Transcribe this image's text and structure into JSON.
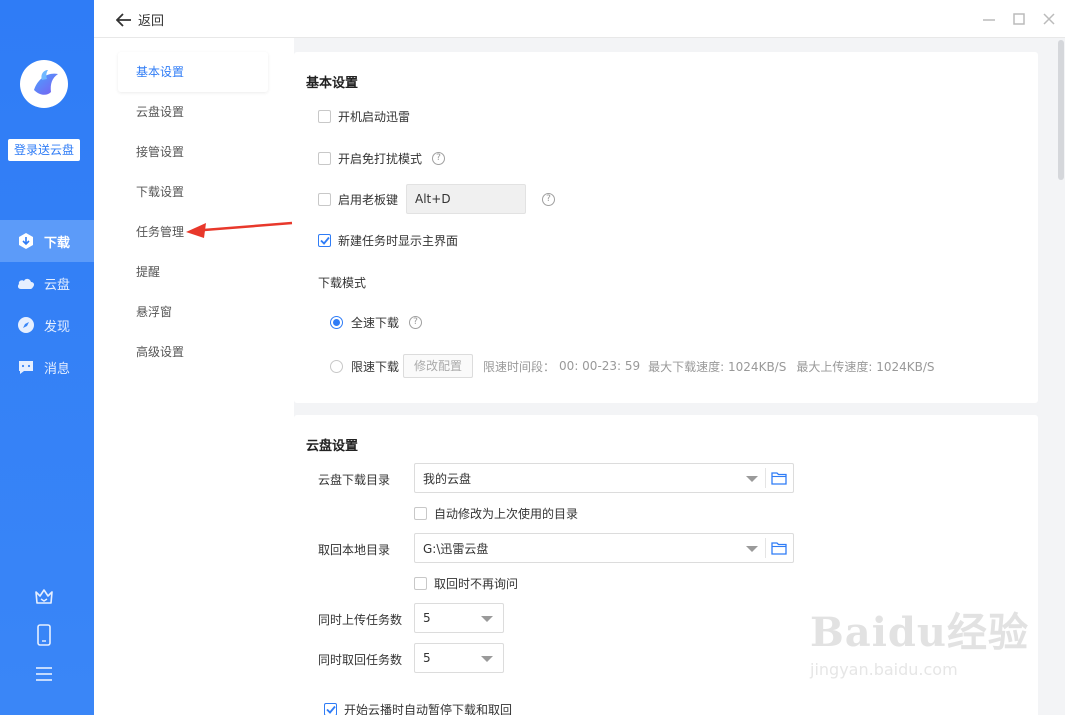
{
  "sidebar": {
    "login_label": "登录送云盘",
    "items": [
      {
        "label": "下载",
        "icon": "download-icon",
        "active": true
      },
      {
        "label": "云盘",
        "icon": "cloud-icon",
        "active": false
      },
      {
        "label": "发现",
        "icon": "compass-icon",
        "active": false
      },
      {
        "label": "消息",
        "icon": "message-icon",
        "active": false
      }
    ],
    "bottom_icons": [
      "crown-icon",
      "phone-icon",
      "menu-icon"
    ]
  },
  "header": {
    "back_label": "返回"
  },
  "settings_nav": {
    "items": [
      {
        "label": "基本设置",
        "active": true
      },
      {
        "label": "云盘设置",
        "active": false
      },
      {
        "label": "接管设置",
        "active": false
      },
      {
        "label": "下载设置",
        "active": false
      },
      {
        "label": "任务管理",
        "active": false
      },
      {
        "label": "提醒",
        "active": false
      },
      {
        "label": "悬浮窗",
        "active": false
      },
      {
        "label": "高级设置",
        "active": false
      }
    ]
  },
  "basic": {
    "title": "基本设置",
    "startup_label": "开机启动迅雷",
    "startup_checked": false,
    "quiet_label": "开启免打扰模式",
    "quiet_checked": false,
    "boss_key_label": "启用老板键",
    "boss_key_checked": false,
    "boss_key_value": "Alt+D",
    "show_main_label": "新建任务时显示主界面",
    "show_main_checked": true,
    "download_mode_label": "下载模式",
    "full_speed_label": "全速下载",
    "full_speed_selected": true,
    "limited_label": "限速下载",
    "modify_config_label": "修改配置",
    "limit_time_label": "限速时间段：",
    "limit_time_value": "00: 00-23: 59",
    "max_down_label": "最大下载速度: 1024KB/S",
    "max_up_label": "最大上传速度: 1024KB/S",
    "help_glyph": "?"
  },
  "cloud": {
    "title": "云盘设置",
    "download_dir_label": "云盘下载目录",
    "download_dir_value": "我的云盘",
    "auto_modify_label": "自动修改为上次使用的目录",
    "auto_modify_checked": false,
    "local_dir_label": "取回本地目录",
    "local_dir_value": "G:\\迅雷云盘",
    "no_ask_label": "取回时不再询问",
    "no_ask_checked": false,
    "upload_count_label": "同时上传任务数",
    "upload_count_value": "5",
    "retrieve_count_label": "同时取回任务数",
    "retrieve_count_value": "5",
    "pause_label": "开始云播时自动暂停下载和取回",
    "pause_checked": true
  },
  "watermark": {
    "big": "Baidu经验",
    "small": "jingyan.baidu.com"
  },
  "colors": {
    "accent": "#2f7cf6",
    "rail_active": "#5c9bf9",
    "annotation_arrow": "#e8382b"
  }
}
